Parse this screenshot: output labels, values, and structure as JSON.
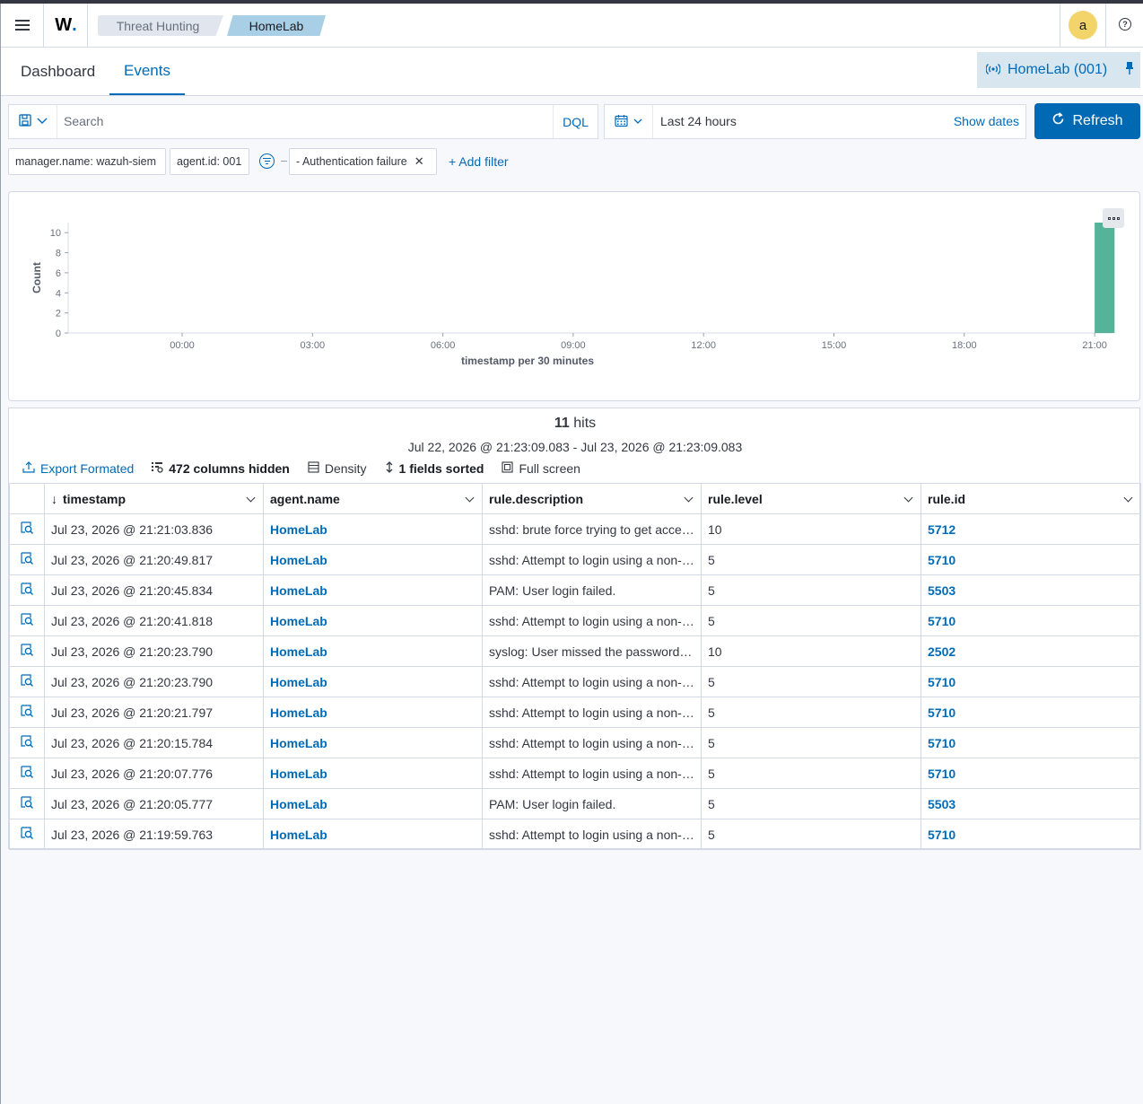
{
  "header": {
    "logo_text": "W",
    "logo_dot": ".",
    "breadcrumbs": [
      "Threat Hunting",
      "HomeLab"
    ],
    "avatar_letter": "a",
    "help_glyph": "?"
  },
  "tabs": [
    {
      "label": "Dashboard",
      "active": false
    },
    {
      "label": "Events",
      "active": true
    }
  ],
  "agent_selector": {
    "label": "HomeLab (001)"
  },
  "query_bar": {
    "placeholder": "Search",
    "language": "DQL",
    "date_range": "Last 24 hours",
    "show_dates_label": "Show dates",
    "refresh_label": "Refresh"
  },
  "filters": [
    "manager.name: wazuh-siem",
    "agent.id: 001",
    "- Authentication failure"
  ],
  "add_filter_label": "+ Add filter",
  "chart_data": {
    "type": "bar",
    "xlabel": "timestamp per 30 minutes",
    "ylabel": "Count",
    "ylim": [
      0,
      11
    ],
    "y_ticks": [
      0,
      2,
      4,
      6,
      8,
      10
    ],
    "x_ticks": [
      "00:00",
      "03:00",
      "06:00",
      "09:00",
      "12:00",
      "15:00",
      "18:00",
      "21:00"
    ],
    "bars": [
      {
        "x": "21:00",
        "value": 11
      }
    ],
    "bar_color": "#54b399",
    "grid": false
  },
  "results": {
    "hits_count": "11",
    "hits_label": "hits",
    "date_range": "Jul 22, 2026 @ 21:23:09.083 - Jul 23, 2026 @ 21:23:09.083",
    "toolbar": {
      "export": "Export Formated",
      "columns_hidden": "472 columns hidden",
      "density": "Density",
      "sorted": "1 fields sorted",
      "fullscreen": "Full screen"
    },
    "columns": [
      "timestamp",
      "agent.name",
      "rule.description",
      "rule.level",
      "rule.id"
    ],
    "rows": [
      {
        "timestamp": "Jul 23, 2026 @ 21:21:03.836",
        "agent": "HomeLab",
        "description": "sshd: brute force trying to get access to the system.",
        "level": "10",
        "rule_id": "5712"
      },
      {
        "timestamp": "Jul 23, 2026 @ 21:20:49.817",
        "agent": "HomeLab",
        "description": "sshd: Attempt to login using a non-existent user",
        "level": "5",
        "rule_id": "5710"
      },
      {
        "timestamp": "Jul 23, 2026 @ 21:20:45.834",
        "agent": "HomeLab",
        "description": "PAM: User login failed.",
        "level": "5",
        "rule_id": "5503"
      },
      {
        "timestamp": "Jul 23, 2026 @ 21:20:41.818",
        "agent": "HomeLab",
        "description": "sshd: Attempt to login using a non-existent user",
        "level": "5",
        "rule_id": "5710"
      },
      {
        "timestamp": "Jul 23, 2026 @ 21:20:23.790",
        "agent": "HomeLab",
        "description": "syslog: User missed the password more than one time",
        "level": "10",
        "rule_id": "2502"
      },
      {
        "timestamp": "Jul 23, 2026 @ 21:20:23.790",
        "agent": "HomeLab",
        "description": "sshd: Attempt to login using a non-existent user",
        "level": "5",
        "rule_id": "5710"
      },
      {
        "timestamp": "Jul 23, 2026 @ 21:20:21.797",
        "agent": "HomeLab",
        "description": "sshd: Attempt to login using a non-existent user",
        "level": "5",
        "rule_id": "5710"
      },
      {
        "timestamp": "Jul 23, 2026 @ 21:20:15.784",
        "agent": "HomeLab",
        "description": "sshd: Attempt to login using a non-existent user",
        "level": "5",
        "rule_id": "5710"
      },
      {
        "timestamp": "Jul 23, 2026 @ 21:20:07.776",
        "agent": "HomeLab",
        "description": "sshd: Attempt to login using a non-existent user",
        "level": "5",
        "rule_id": "5710"
      },
      {
        "timestamp": "Jul 23, 2026 @ 21:20:05.777",
        "agent": "HomeLab",
        "description": "PAM: User login failed.",
        "level": "5",
        "rule_id": "5503"
      },
      {
        "timestamp": "Jul 23, 2026 @ 21:19:59.763",
        "agent": "HomeLab",
        "description": "sshd: Attempt to login using a non-existent user",
        "level": "5",
        "rule_id": "5710"
      }
    ]
  },
  "icons": {
    "menu": "hamburger-icon",
    "saved_query": "save-icon",
    "calendar": "calendar-icon",
    "refresh": "refresh-icon",
    "agent": "signal-icon",
    "pin": "pin-icon",
    "inspect": "inspect-icon"
  },
  "colors": {
    "accent": "#006bb8",
    "primary_button": "#0069b4",
    "bar": "#54b399"
  }
}
